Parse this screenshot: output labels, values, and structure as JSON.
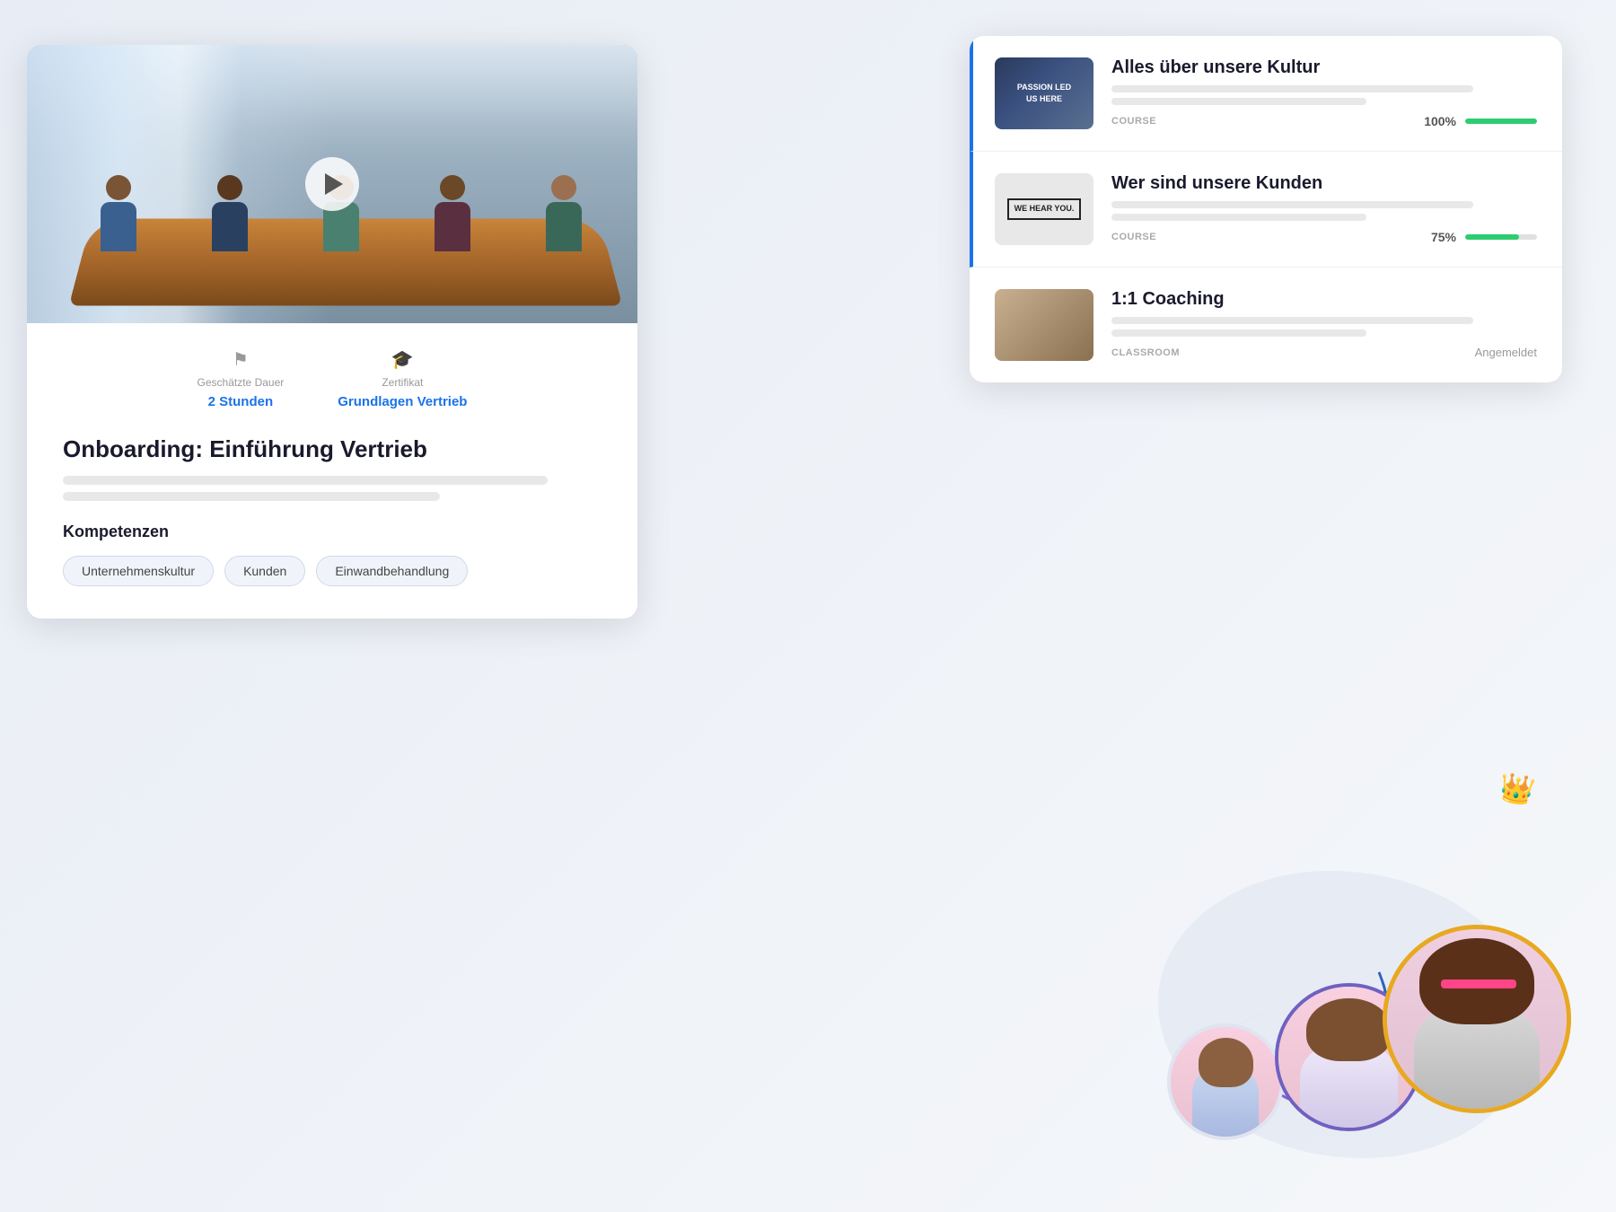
{
  "scene": {
    "background": "#f0f2f5"
  },
  "card_left": {
    "meta": {
      "duration_label": "Geschätzte Dauer",
      "duration_value": "2 Stunden",
      "cert_label": "Zertifikat",
      "cert_value": "Grundlagen Vertrieb"
    },
    "course_title": "Onboarding: Einführung Vertrieb",
    "description_lines": [
      "long",
      "medium"
    ],
    "kompetenzen_title": "Kompetenzen",
    "tags": [
      "Unternehmenskultur",
      "Kunden",
      "Einwandbehandlung"
    ]
  },
  "card_right": {
    "courses": [
      {
        "title": "Alles über unsere Kultur",
        "type": "COURSE",
        "progress_pct": "100%",
        "progress_val": 100,
        "status": ""
      },
      {
        "title": "Wer sind unsere Kunden",
        "type": "COURSE",
        "progress_pct": "75%",
        "progress_val": 75,
        "status": ""
      },
      {
        "title": "1:1 Coaching",
        "type": "CLASSROOM",
        "progress_pct": "",
        "progress_val": 0,
        "status": "Angemeldet"
      }
    ]
  },
  "icons": {
    "flag": "⚑",
    "certificate": "🏅",
    "play": "▶",
    "crown": "👑"
  }
}
